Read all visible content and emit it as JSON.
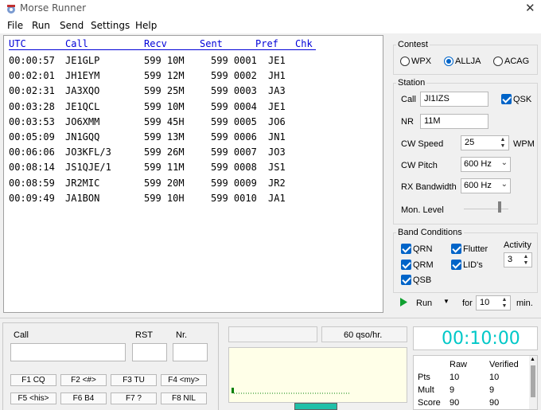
{
  "window": {
    "title": "Morse Runner",
    "close_glyph": "✕"
  },
  "menu": [
    "File",
    "Run",
    "Send",
    "Settings",
    "Help"
  ],
  "log": {
    "headers": [
      "UTC",
      "Call",
      "Recv",
      "Sent",
      "Pref",
      "Chk"
    ],
    "rows": [
      [
        "00:00:57",
        "JE1GLP",
        "599 10M",
        "599 0001",
        "JE1"
      ],
      [
        "00:02:01",
        "JH1EYM",
        "599 12M",
        "599 0002",
        "JH1"
      ],
      [
        "00:02:31",
        "JA3XQO",
        "599 25M",
        "599 0003",
        "JA3"
      ],
      [
        "00:03:28",
        "JE1QCL",
        "599 10M",
        "599 0004",
        "JE1"
      ],
      [
        "00:03:53",
        "JO6XMM",
        "599 45H",
        "599 0005",
        "JO6"
      ],
      [
        "00:05:09",
        "JN1GQQ",
        "599 13M",
        "599 0006",
        "JN1"
      ],
      [
        "00:06:06",
        "JO3KFL/3",
        "599 26M",
        "599 0007",
        "JO3"
      ],
      [
        "00:08:14",
        "JS1QJE/1",
        "599 11M",
        "599 0008",
        "JS1"
      ],
      [
        "00:08:59",
        "JR2MIC",
        "599 20M",
        "599 0009",
        "JR2"
      ],
      [
        "00:09:49",
        "JA1BON",
        "599 10H",
        "599 0010",
        "JA1"
      ]
    ]
  },
  "contest": {
    "title": "Contest",
    "options": [
      "WPX",
      "ALLJA",
      "ACAG"
    ],
    "selected": "ALLJA"
  },
  "station": {
    "title": "Station",
    "call_label": "Call",
    "call_value": "JI1IZS",
    "qsk_label": "QSK",
    "qsk_checked": true,
    "nr_label": "NR",
    "nr_value": "11M",
    "cw_speed_label": "CW Speed",
    "cw_speed_value": "25",
    "wpm_label": "WPM",
    "cw_pitch_label": "CW Pitch",
    "cw_pitch_value": "600 Hz",
    "rx_bw_label": "RX Bandwidth",
    "rx_bw_value": "600 Hz",
    "mon_level_label": "Mon. Level",
    "mon_level_fraction": 0.85
  },
  "band": {
    "title": "Band Conditions",
    "checks": [
      {
        "label": "QRN",
        "checked": true
      },
      {
        "label": "Flutter",
        "checked": true
      },
      {
        "label": "QRM",
        "checked": true
      },
      {
        "label": "LID's",
        "checked": true
      },
      {
        "label": "QSB",
        "checked": true
      }
    ],
    "activity_label": "Activity",
    "activity_value": "3"
  },
  "run": {
    "run_label": "Run",
    "for_label": "for",
    "minutes_value": "10",
    "min_label": "min."
  },
  "entry": {
    "call_label": "Call",
    "rst_label": "RST",
    "nr_label": "Nr.",
    "call_value": "",
    "rst_value": "",
    "nr_value": "",
    "fkeys": [
      "F1 CQ",
      "F2 <#>",
      "F3 TU",
      "F4 <my>",
      "F5 <his>",
      "F6 B4",
      "F7 ?",
      "F8 NIL"
    ]
  },
  "rate": {
    "value": "60 qso/hr."
  },
  "clock": {
    "value": "00:10:00"
  },
  "score": {
    "col_raw": "Raw",
    "col_verified": "Verified",
    "rows": [
      [
        "Pts",
        "10",
        "10"
      ],
      [
        "Mult",
        "9",
        "9"
      ],
      [
        "Score",
        "90",
        "90"
      ]
    ]
  },
  "colors": {
    "accent": "#0064c8",
    "log_header": "#0000d8",
    "clock": "#00c8c8",
    "graph_bg": "#ffffe8",
    "graph_line": "#008000",
    "progress": "#20c0a8"
  }
}
